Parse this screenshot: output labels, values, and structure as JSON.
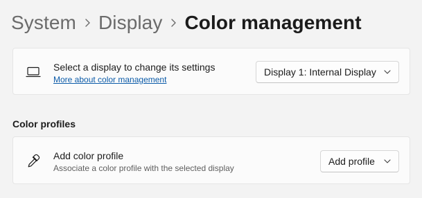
{
  "breadcrumb": {
    "items": [
      "System",
      "Display"
    ],
    "current": "Color management"
  },
  "display_row": {
    "icon": "laptop-icon",
    "title": "Select a display to change its settings",
    "link": "More about color management",
    "dropdown_value": "Display 1: Internal Display"
  },
  "section": {
    "title": "Color profiles"
  },
  "profile_row": {
    "icon": "eyedropper-icon",
    "title": "Add color profile",
    "subtitle": "Associate a color profile with the selected display",
    "button_label": "Add profile"
  },
  "colors": {
    "background": "#f3f3f3",
    "card": "#fbfbfb",
    "link": "#0a5aa8"
  }
}
